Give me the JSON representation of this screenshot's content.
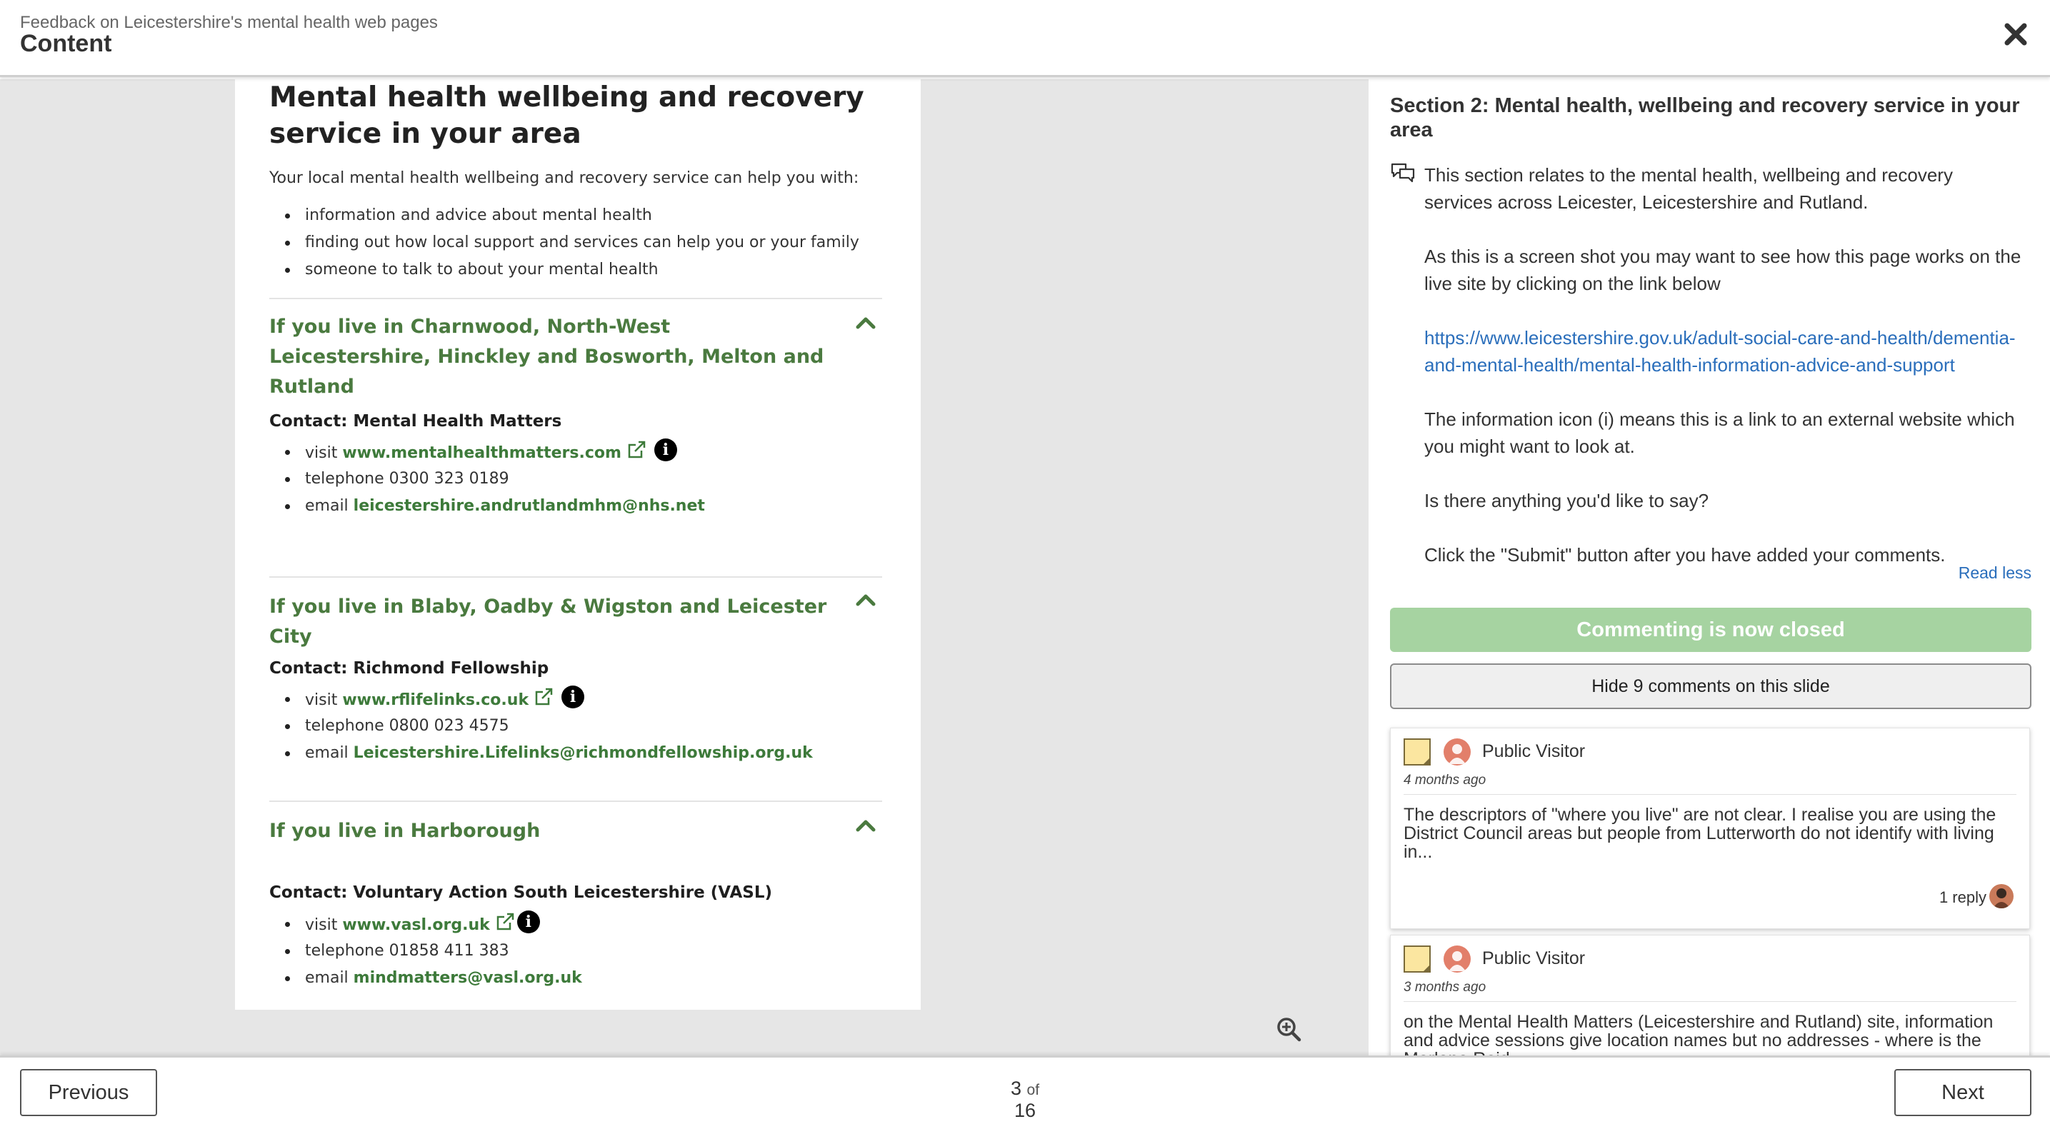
{
  "header": {
    "subtitle": "Feedback on Leicestershire's mental health web pages",
    "title": "Content",
    "close_icon": "close-icon"
  },
  "slide": {
    "heading": "Mental health wellbeing and recovery service in your area",
    "intro": "Your local mental health wellbeing and recovery service can help you with:",
    "intro_bullets": [
      "information and advice about mental health",
      "finding out how local support and services can help you or your family",
      "someone to talk to about your mental health"
    ],
    "sections": [
      {
        "heading": "If you live in Charnwood, North-West Leicestershire, Hinckley and Bosworth, Melton and Rutland",
        "contact": "Contact: Mental Health Matters",
        "visit_prefix": "visit ",
        "visit_link": "www.mentalhealthmatters.com",
        "telephone": "telephone 0300 323 0189",
        "email_prefix": "email ",
        "email": "leicestershire.andrutlandmhm@nhs.net"
      },
      {
        "heading": "If you live in Blaby, Oadby & Wigston and Leicester City",
        "contact": "Contact: Richmond Fellowship",
        "visit_prefix": "visit ",
        "visit_link": "www.rflifelinks.co.uk",
        "telephone": "telephone 0800 023 4575",
        "email_prefix": "email ",
        "email": "Leicestershire.Lifelinks@richmondfellowship.org.uk"
      },
      {
        "heading": "If you live in Harborough",
        "contact": "Contact: Voluntary Action South Leicestershire (VASL)",
        "visit_prefix": "visit ",
        "visit_link": "www.vasl.org.uk",
        "telephone": "telephone 01858 411 383",
        "email_prefix": "email ",
        "email": "mindmatters@vasl.org.uk"
      }
    ],
    "info_glyph": "i",
    "zoom_icon": "zoom-in-icon"
  },
  "panel": {
    "title": "Section 2: Mental health, wellbeing and recovery service in your area",
    "paragraphs": [
      "This section relates to the mental health, wellbeing and recovery services across Leicester, Leicestershire and Rutland.",
      "As this is a screen shot you may want to see how this page works on the live site by clicking on the link below"
    ],
    "link": "https://www.leicestershire.gov.uk/adult-social-care-and-health/dementia-and-mental-health/mental-health-information-advice-and-support",
    "paragraphs_after": [
      "The information icon (i) means this is a link to an external website which you might want to look at.",
      "Is there anything you'd like to say?",
      "Click the \"Submit\" button after you have added your comments."
    ],
    "read_less": "Read less",
    "commenting_closed": "Commenting is now closed",
    "hide_comments": "Hide 9 comments on this slide",
    "comments": [
      {
        "author": "Public Visitor",
        "ago": "4 months ago",
        "text": "The descriptors of \"where you live\" are not clear. I realise you are using the District Council areas but people from Lutterworth do not identify with living in...",
        "replies": "1 reply"
      },
      {
        "author": "Public Visitor",
        "ago": "3 months ago",
        "text": "on the Mental Health Matters (Leicestershire and Rutland) site, information and advice sessions give location names but no addresses - where is the Marlene Reid..."
      }
    ]
  },
  "footer": {
    "previous": "Previous",
    "next": "Next",
    "page_current": "3",
    "page_of": "of",
    "page_total": "16"
  },
  "colors": {
    "accent_green": "#4a7a3f",
    "link_blue": "#2a6ebb",
    "closed_button": "#a6d3a1",
    "stage_bg": "#e6e6e6"
  }
}
